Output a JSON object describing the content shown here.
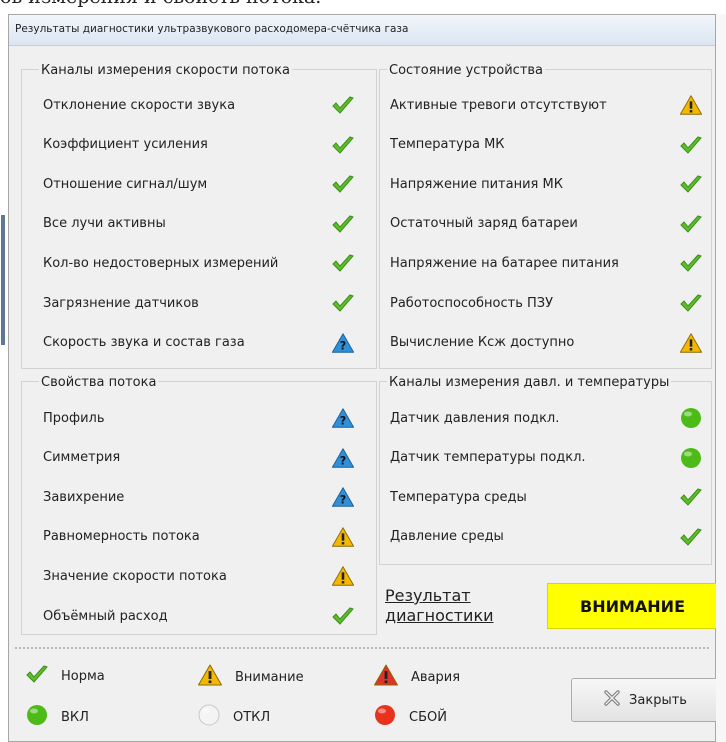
{
  "caption": "ов измерения и свойств потока.",
  "window": {
    "title": "Результаты диагностики ультразвукового расходомера-счётчика газа"
  },
  "groups": {
    "flow_channels": {
      "title": "Каналы измерения скорости потока",
      "items": [
        {
          "label": "Отклонение скорости звука",
          "status": "check-icon"
        },
        {
          "label": "Коэффициент усиления",
          "status": "check-icon"
        },
        {
          "label": "Отношение сигнал/шум",
          "status": "check-icon"
        },
        {
          "label": "Все лучи активны",
          "status": "check-icon"
        },
        {
          "label": "Кол-во недостоверных измерений",
          "status": "check-icon"
        },
        {
          "label": "Загрязнение датчиков",
          "status": "check-icon"
        },
        {
          "label": "Скорость звука и состав газа",
          "status": "question-icon"
        }
      ]
    },
    "device_state": {
      "title": "Состояние устройства",
      "items": [
        {
          "label": "Активные тревоги отсутствуют",
          "status": "warning-icon"
        },
        {
          "label": "Температура МК",
          "status": "check-icon"
        },
        {
          "label": "Напряжение питания МК",
          "status": "check-icon"
        },
        {
          "label": "Остаточный заряд батареи",
          "status": "check-icon"
        },
        {
          "label": "Напряжение на батарее питания",
          "status": "check-icon"
        },
        {
          "label": "Работоспособность ПЗУ",
          "status": "check-icon"
        },
        {
          "label": "Вычисление Ксж доступно",
          "status": "warning-icon"
        }
      ]
    },
    "flow_properties": {
      "title": "Свойства потока",
      "items": [
        {
          "label": "Профиль",
          "status": "question-icon"
        },
        {
          "label": "Симметрия",
          "status": "question-icon"
        },
        {
          "label": "Завихрение",
          "status": "question-icon"
        },
        {
          "label": "Равномерность потока",
          "status": "warning-icon"
        },
        {
          "label": "Значение скорости потока",
          "status": "warning-icon"
        },
        {
          "label": "Объёмный расход",
          "status": "check-icon"
        }
      ]
    },
    "pressure_temp": {
      "title": "Каналы измерения давл. и температуры",
      "items": [
        {
          "label": "Датчик давления подкл.",
          "status": "green-dot-icon"
        },
        {
          "label": "Датчик температуры подкл.",
          "status": "green-dot-icon"
        },
        {
          "label": "Температура среды",
          "status": "check-icon"
        },
        {
          "label": "Давление среды",
          "status": "check-icon"
        }
      ]
    }
  },
  "result": {
    "label": "Результат диагностики",
    "value": "ВНИМАНИЕ",
    "badge_color": "#ffff00"
  },
  "legend": [
    {
      "label": "Норма",
      "icon": "check-icon"
    },
    {
      "label": "Внимание",
      "icon": "warning-icon"
    },
    {
      "label": "Авария",
      "icon": "alarm-icon"
    },
    {
      "label": "ВКЛ",
      "icon": "green-dot-icon"
    },
    {
      "label": "ОТКЛ",
      "icon": "white-dot-icon"
    },
    {
      "label": "СБОЙ",
      "icon": "red-dot-icon"
    }
  ],
  "close_button": {
    "label": "Закрыть",
    "icon": "close-icon"
  },
  "colors": {
    "check": "#5cbf2a",
    "warning": "#f5b800",
    "alarm": "#e0322a",
    "question": "#2f8fd8",
    "on": "#4cbb17",
    "off": "#f4f4f4",
    "fault": "#e8321e"
  }
}
